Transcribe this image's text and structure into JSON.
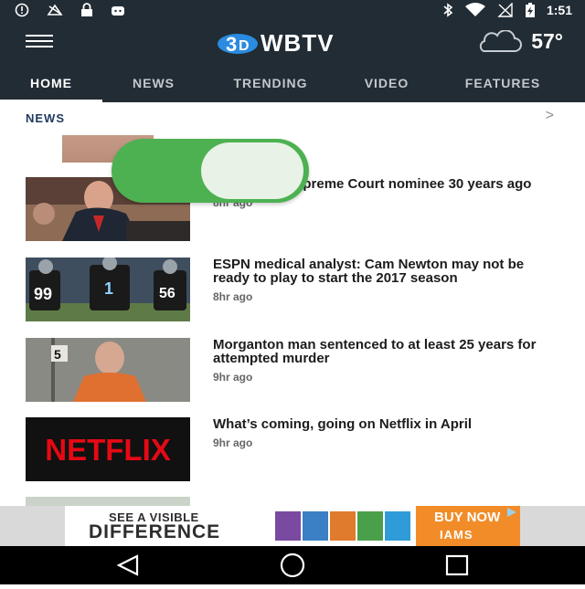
{
  "status_bar": {
    "time": "1:51"
  },
  "app_bar": {
    "logo_number": "3",
    "logo_text": "WBTV",
    "temperature": "57°"
  },
  "tabs": [
    {
      "label": "HOME",
      "active": true
    },
    {
      "label": "NEWS",
      "active": false
    },
    {
      "label": "TRENDING",
      "active": false
    },
    {
      "label": "VIDEO",
      "active": false
    },
    {
      "label": "FEATURES",
      "active": false
    }
  ],
  "section": {
    "title": "NEWS",
    "chevron": ">"
  },
  "stories": [
    {
      "headline": "st rejected Supreme Court nominee 30 years ago",
      "time": "8hr ago"
    },
    {
      "headline": "ESPN medical analyst: Cam Newton may not be ready to play to start the 2017 season",
      "time": "8hr ago"
    },
    {
      "headline": "Morganton man sentenced to at least 25 years for attempted murder",
      "time": "9hr ago"
    },
    {
      "headline": "What’s coming, going on Netflix in April",
      "time": "9hr ago"
    }
  ],
  "thumb_texts": {
    "jersey_1": "99",
    "jersey_2": "1",
    "jersey_3": "56",
    "mugshot_number": "5",
    "netflix": "NETFLIX"
  },
  "ad": {
    "line1": "SEE A VISIBLE",
    "line2": "DIFFERENCE",
    "cta": "BUY NOW",
    "brand": "IAMS"
  },
  "colors": {
    "app_bar": "#222c34",
    "toggle_green": "#4db152",
    "section_title": "#1e3a5f",
    "ad_cta": "#f28c28"
  }
}
